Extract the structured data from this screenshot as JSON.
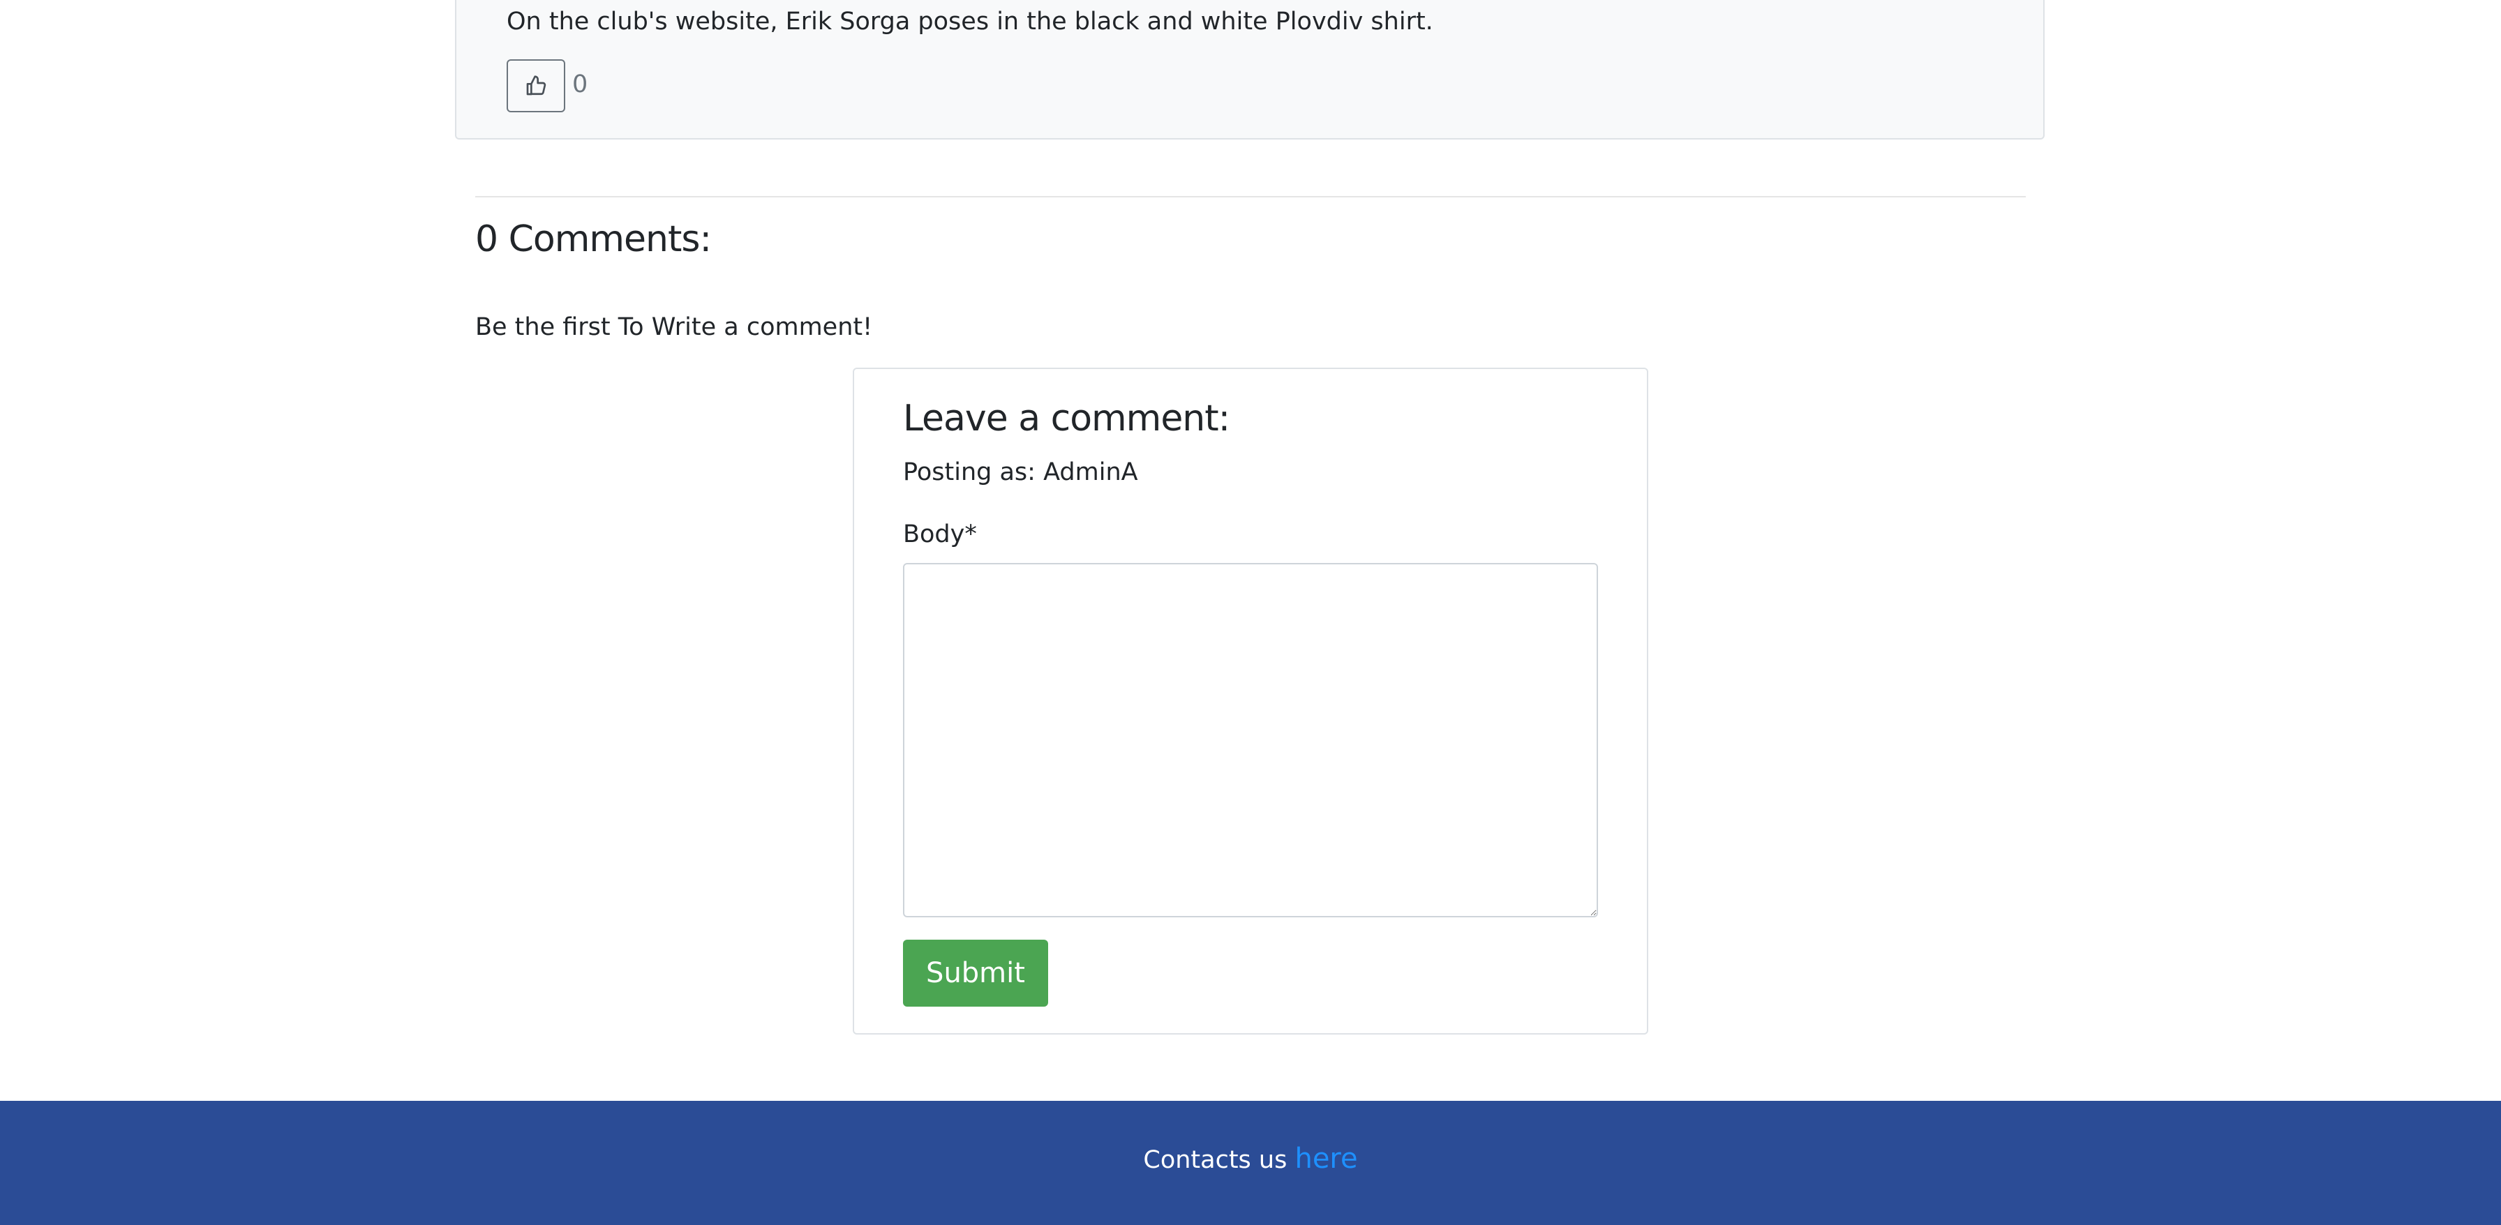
{
  "post": {
    "caption": "On the club's website, Erik Sorga poses in the black and white Plovdiv shirt.",
    "like_count": "0",
    "like_icon": "thumbs-up-icon"
  },
  "comments": {
    "heading": "0 Comments:",
    "empty_message": "Be the first To Write a comment!"
  },
  "comment_form": {
    "title": "Leave a comment:",
    "posting_as": "Posting as: AdminA",
    "body_label": "Body*",
    "body_value": "",
    "submit_label": "Submit"
  },
  "footer": {
    "text": "Contacts us",
    "link_label": "here"
  },
  "colors": {
    "card_bg": "#f8f9fa",
    "submit_green": "#4ba552",
    "footer_blue": "#2b4c96",
    "link_blue": "#1e90ff"
  }
}
